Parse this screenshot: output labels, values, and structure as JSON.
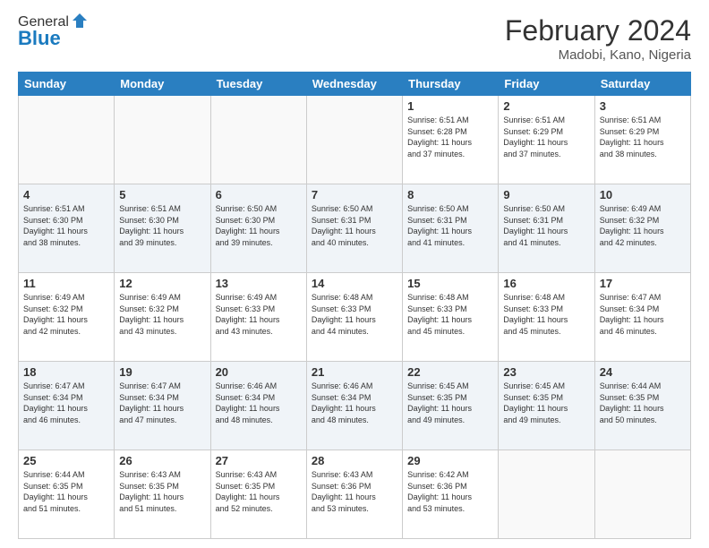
{
  "logo": {
    "general": "General",
    "blue": "Blue"
  },
  "title": "February 2024",
  "subtitle": "Madobi, Kano, Nigeria",
  "headers": [
    "Sunday",
    "Monday",
    "Tuesday",
    "Wednesday",
    "Thursday",
    "Friday",
    "Saturday"
  ],
  "weeks": [
    [
      {
        "day": "",
        "info": ""
      },
      {
        "day": "",
        "info": ""
      },
      {
        "day": "",
        "info": ""
      },
      {
        "day": "",
        "info": ""
      },
      {
        "day": "1",
        "info": "Sunrise: 6:51 AM\nSunset: 6:28 PM\nDaylight: 11 hours\nand 37 minutes."
      },
      {
        "day": "2",
        "info": "Sunrise: 6:51 AM\nSunset: 6:29 PM\nDaylight: 11 hours\nand 37 minutes."
      },
      {
        "day": "3",
        "info": "Sunrise: 6:51 AM\nSunset: 6:29 PM\nDaylight: 11 hours\nand 38 minutes."
      }
    ],
    [
      {
        "day": "4",
        "info": "Sunrise: 6:51 AM\nSunset: 6:30 PM\nDaylight: 11 hours\nand 38 minutes."
      },
      {
        "day": "5",
        "info": "Sunrise: 6:51 AM\nSunset: 6:30 PM\nDaylight: 11 hours\nand 39 minutes."
      },
      {
        "day": "6",
        "info": "Sunrise: 6:50 AM\nSunset: 6:30 PM\nDaylight: 11 hours\nand 39 minutes."
      },
      {
        "day": "7",
        "info": "Sunrise: 6:50 AM\nSunset: 6:31 PM\nDaylight: 11 hours\nand 40 minutes."
      },
      {
        "day": "8",
        "info": "Sunrise: 6:50 AM\nSunset: 6:31 PM\nDaylight: 11 hours\nand 41 minutes."
      },
      {
        "day": "9",
        "info": "Sunrise: 6:50 AM\nSunset: 6:31 PM\nDaylight: 11 hours\nand 41 minutes."
      },
      {
        "day": "10",
        "info": "Sunrise: 6:49 AM\nSunset: 6:32 PM\nDaylight: 11 hours\nand 42 minutes."
      }
    ],
    [
      {
        "day": "11",
        "info": "Sunrise: 6:49 AM\nSunset: 6:32 PM\nDaylight: 11 hours\nand 42 minutes."
      },
      {
        "day": "12",
        "info": "Sunrise: 6:49 AM\nSunset: 6:32 PM\nDaylight: 11 hours\nand 43 minutes."
      },
      {
        "day": "13",
        "info": "Sunrise: 6:49 AM\nSunset: 6:33 PM\nDaylight: 11 hours\nand 43 minutes."
      },
      {
        "day": "14",
        "info": "Sunrise: 6:48 AM\nSunset: 6:33 PM\nDaylight: 11 hours\nand 44 minutes."
      },
      {
        "day": "15",
        "info": "Sunrise: 6:48 AM\nSunset: 6:33 PM\nDaylight: 11 hours\nand 45 minutes."
      },
      {
        "day": "16",
        "info": "Sunrise: 6:48 AM\nSunset: 6:33 PM\nDaylight: 11 hours\nand 45 minutes."
      },
      {
        "day": "17",
        "info": "Sunrise: 6:47 AM\nSunset: 6:34 PM\nDaylight: 11 hours\nand 46 minutes."
      }
    ],
    [
      {
        "day": "18",
        "info": "Sunrise: 6:47 AM\nSunset: 6:34 PM\nDaylight: 11 hours\nand 46 minutes."
      },
      {
        "day": "19",
        "info": "Sunrise: 6:47 AM\nSunset: 6:34 PM\nDaylight: 11 hours\nand 47 minutes."
      },
      {
        "day": "20",
        "info": "Sunrise: 6:46 AM\nSunset: 6:34 PM\nDaylight: 11 hours\nand 48 minutes."
      },
      {
        "day": "21",
        "info": "Sunrise: 6:46 AM\nSunset: 6:34 PM\nDaylight: 11 hours\nand 48 minutes."
      },
      {
        "day": "22",
        "info": "Sunrise: 6:45 AM\nSunset: 6:35 PM\nDaylight: 11 hours\nand 49 minutes."
      },
      {
        "day": "23",
        "info": "Sunrise: 6:45 AM\nSunset: 6:35 PM\nDaylight: 11 hours\nand 49 minutes."
      },
      {
        "day": "24",
        "info": "Sunrise: 6:44 AM\nSunset: 6:35 PM\nDaylight: 11 hours\nand 50 minutes."
      }
    ],
    [
      {
        "day": "25",
        "info": "Sunrise: 6:44 AM\nSunset: 6:35 PM\nDaylight: 11 hours\nand 51 minutes."
      },
      {
        "day": "26",
        "info": "Sunrise: 6:43 AM\nSunset: 6:35 PM\nDaylight: 11 hours\nand 51 minutes."
      },
      {
        "day": "27",
        "info": "Sunrise: 6:43 AM\nSunset: 6:35 PM\nDaylight: 11 hours\nand 52 minutes."
      },
      {
        "day": "28",
        "info": "Sunrise: 6:43 AM\nSunset: 6:36 PM\nDaylight: 11 hours\nand 53 minutes."
      },
      {
        "day": "29",
        "info": "Sunrise: 6:42 AM\nSunset: 6:36 PM\nDaylight: 11 hours\nand 53 minutes."
      },
      {
        "day": "",
        "info": ""
      },
      {
        "day": "",
        "info": ""
      }
    ]
  ]
}
